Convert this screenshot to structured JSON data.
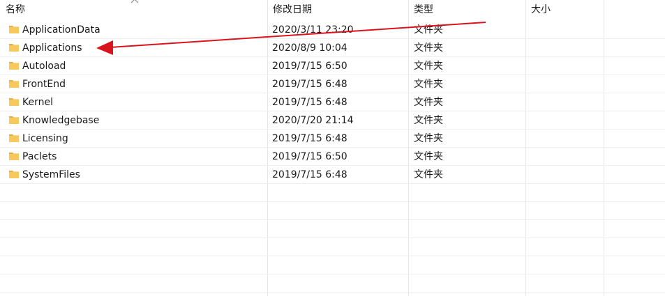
{
  "columns": {
    "name": "名称",
    "date": "修改日期",
    "type": "类型",
    "size": "大小"
  },
  "rows": [
    {
      "name": "ApplicationData",
      "date": "2020/3/11 23:20",
      "type": "文件夹",
      "size": ""
    },
    {
      "name": "Applications",
      "date": "2020/8/9 10:04",
      "type": "文件夹",
      "size": ""
    },
    {
      "name": "Autoload",
      "date": "2019/7/15 6:50",
      "type": "文件夹",
      "size": ""
    },
    {
      "name": "FrontEnd",
      "date": "2019/7/15 6:48",
      "type": "文件夹",
      "size": ""
    },
    {
      "name": "Kernel",
      "date": "2019/7/15 6:48",
      "type": "文件夹",
      "size": ""
    },
    {
      "name": "Knowledgebase",
      "date": "2020/7/20 21:14",
      "type": "文件夹",
      "size": ""
    },
    {
      "name": "Licensing",
      "date": "2019/7/15 6:48",
      "type": "文件夹",
      "size": ""
    },
    {
      "name": "Paclets",
      "date": "2019/7/15 6:50",
      "type": "文件夹",
      "size": ""
    },
    {
      "name": "SystemFiles",
      "date": "2019/7/15 6:48",
      "type": "文件夹",
      "size": ""
    }
  ],
  "icons": {
    "row_icon": "folder-icon",
    "sort": "chevron-up-icon",
    "annotation": "red-arrow-annotation"
  },
  "colors": {
    "folder": "#f7c95c",
    "folder_dark": "#e7b03a",
    "arrow": "#d9141c",
    "grid": "#e5e5e5"
  }
}
